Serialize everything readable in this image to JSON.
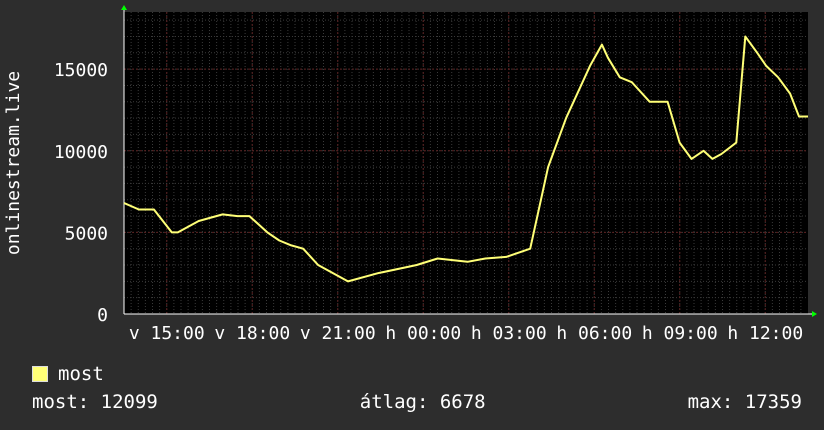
{
  "chart_data": {
    "type": "line",
    "ylabel": "onlinestream.live",
    "yticks": [
      0,
      5000,
      10000,
      15000
    ],
    "ylim": [
      0,
      18500
    ],
    "xticks": [
      "v 15:00",
      "v 18:00",
      "v 21:00",
      "h 00:00",
      "h 03:00",
      "h 06:00",
      "h 09:00",
      "h 12:00"
    ],
    "xlim": [
      0,
      229
    ],
    "grid": true,
    "colors": {
      "background": "#2d2d2d",
      "plot": "#000000",
      "line": "#ffff77",
      "grid_major": "#5a2020",
      "grid_minor": "#3a3a3a",
      "axis": "#ffffff",
      "arrow": "#00ff00"
    },
    "series": [
      {
        "name": "most",
        "color": "#ffff77",
        "x": [
          0,
          5,
          10,
          16,
          18,
          25,
          33,
          38,
          42,
          48,
          52,
          56,
          60,
          65,
          75,
          85,
          98,
          105,
          115,
          121,
          128,
          136,
          142,
          148,
          156,
          160,
          162,
          166,
          170,
          176,
          182,
          186,
          190,
          194,
          197,
          200,
          205,
          208,
          212,
          215,
          219,
          223,
          226,
          227,
          229
        ],
        "values": [
          6800,
          6400,
          6400,
          5000,
          5000,
          5700,
          6100,
          6000,
          6000,
          5000,
          4500,
          4200,
          4000,
          3000,
          2000,
          2500,
          3000,
          3400,
          3200,
          3400,
          3500,
          4000,
          9000,
          12000,
          15200,
          16500,
          15700,
          14500,
          14200,
          13000,
          13000,
          10500,
          9500,
          10000,
          9500,
          9800,
          10500,
          17000,
          16000,
          15200,
          14500,
          13500,
          12099,
          12099,
          12099
        ]
      }
    ],
    "legend": [
      {
        "label": "most",
        "color": "#ffff77"
      }
    ],
    "stats": {
      "current": "most: 12099",
      "average": "átlag: 6678",
      "max": "max: 17359"
    }
  }
}
